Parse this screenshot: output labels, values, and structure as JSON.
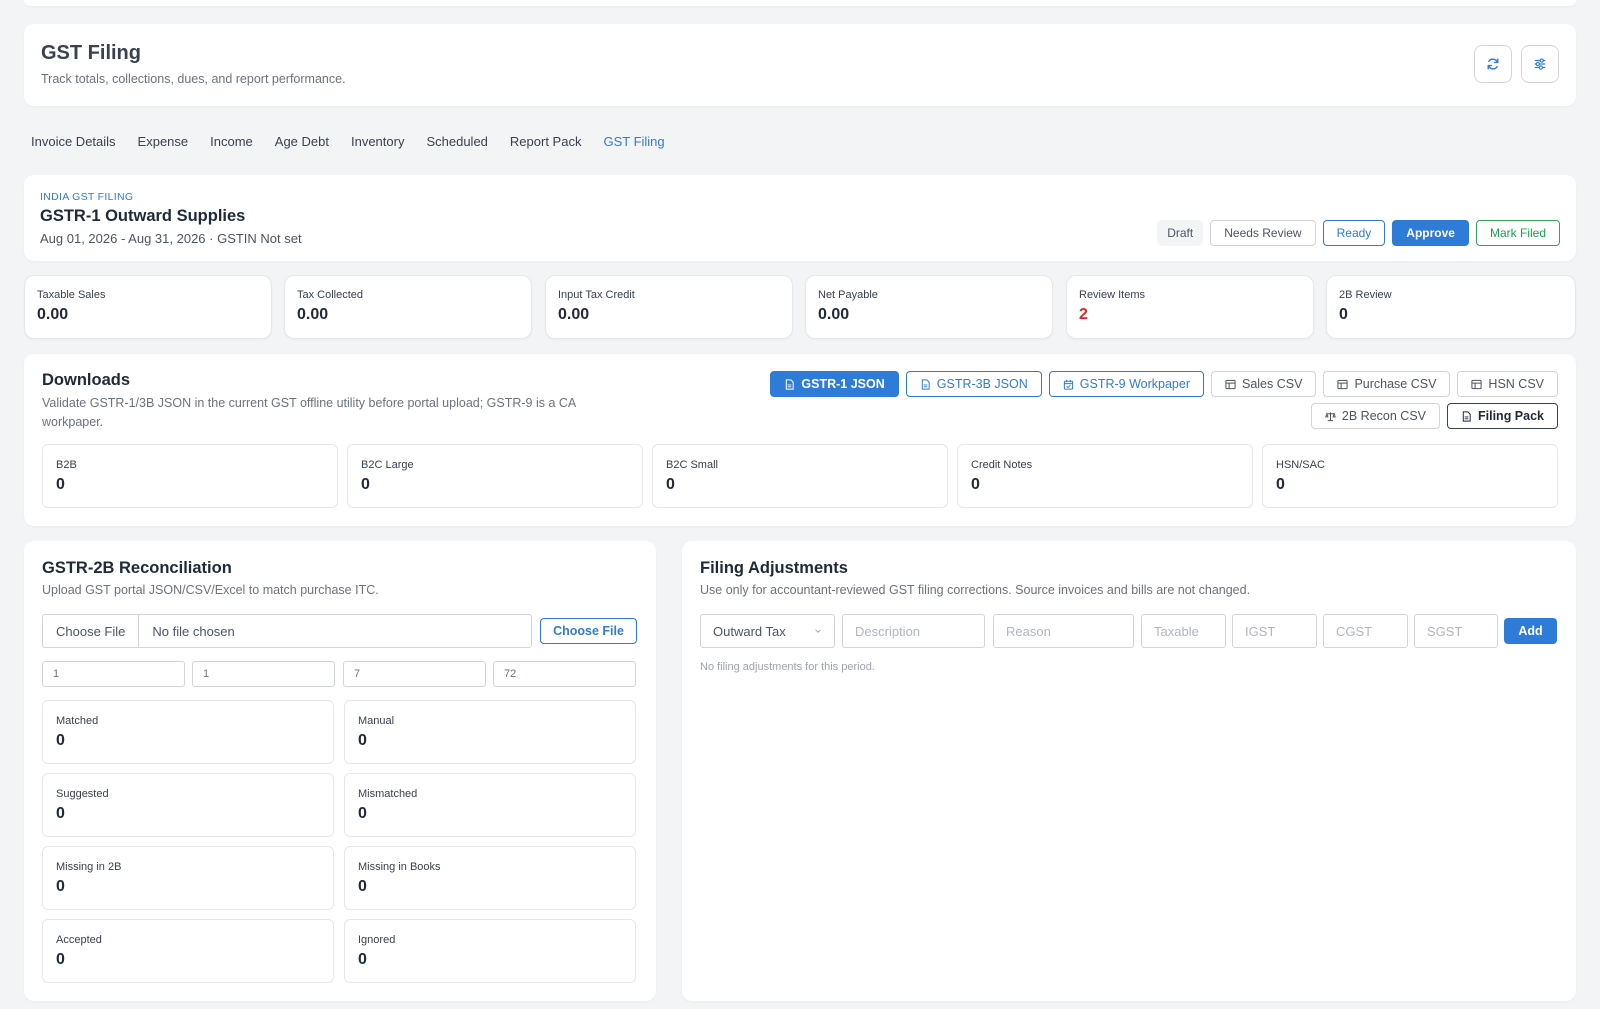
{
  "header": {
    "title": "GST Filing",
    "subtitle": "Track totals, collections, dues, and report performance."
  },
  "icons": {
    "refresh": "refresh-icon",
    "settings": "sliders-icon"
  },
  "tabs": [
    {
      "label": "Invoice Details"
    },
    {
      "label": "Expense"
    },
    {
      "label": "Income"
    },
    {
      "label": "Age Debt"
    },
    {
      "label": "Inventory"
    },
    {
      "label": "Scheduled"
    },
    {
      "label": "Report Pack"
    },
    {
      "label": "GST Filing",
      "active": true
    }
  ],
  "gstr1": {
    "eyebrow": "INDIA GST FILING",
    "title": "GSTR-1 Outward Supplies",
    "period": "Aug 01, 2026 - Aug 31, 2026 · GSTIN Not set",
    "status": {
      "draft": "Draft",
      "needs_review": "Needs Review",
      "ready": "Ready",
      "approve": "Approve",
      "mark_filed": "Mark Filed"
    }
  },
  "stats": [
    {
      "label": "Taxable Sales",
      "value": "0.00"
    },
    {
      "label": "Tax Collected",
      "value": "0.00"
    },
    {
      "label": "Input Tax Credit",
      "value": "0.00"
    },
    {
      "label": "Net Payable",
      "value": "0.00"
    },
    {
      "label": "Review Items",
      "value": "2"
    },
    {
      "label": "2B Review",
      "value": "0"
    }
  ],
  "downloads": {
    "title": "Downloads",
    "description": "Validate GSTR-1/3B JSON in the current GST offline utility before portal upload; GSTR-9 is a CA workpaper.",
    "buttons": {
      "gstr1_json": "GSTR-1 JSON",
      "gstr3b_json": "GSTR-3B JSON",
      "gstr9": "GSTR-9 Workpaper",
      "sales_csv": "Sales CSV",
      "purchase_csv": "Purchase CSV",
      "hsn_csv": "HSN CSV",
      "recon_csv": "2B Recon CSV",
      "filing_pack": "Filing Pack"
    },
    "summary": [
      {
        "label": "B2B",
        "value": "0"
      },
      {
        "label": "B2C Large",
        "value": "0"
      },
      {
        "label": "B2C Small",
        "value": "0"
      },
      {
        "label": "Credit Notes",
        "value": "0"
      },
      {
        "label": "HSN/SAC",
        "value": "0"
      }
    ]
  },
  "recon": {
    "title": "GSTR-2B Reconciliation",
    "description": "Upload GST portal JSON/CSV/Excel to match purchase ITC.",
    "file_button": "Choose File",
    "file_status": "No file chosen",
    "choose_label": "Choose File",
    "inputs": [
      "1",
      "1",
      "7",
      "72"
    ],
    "boxes": [
      {
        "label": "Matched",
        "value": "0"
      },
      {
        "label": "Manual",
        "value": "0"
      },
      {
        "label": "Suggested",
        "value": "0"
      },
      {
        "label": "Mismatched",
        "value": "0"
      },
      {
        "label": "Missing in 2B",
        "value": "0"
      },
      {
        "label": "Missing in Books",
        "value": "0"
      },
      {
        "label": "Accepted",
        "value": "0"
      },
      {
        "label": "Ignored",
        "value": "0"
      }
    ]
  },
  "adjustments": {
    "title": "Filing Adjustments",
    "description": "Use only for accountant-reviewed GST filing corrections. Source invoices and bills are not changed.",
    "type_selected": "Outward Tax",
    "placeholders": {
      "description": "Description",
      "reason": "Reason",
      "taxable": "Taxable",
      "igst": "IGST",
      "cgst": "CGST",
      "sgst": "SGST"
    },
    "add_label": "Add",
    "empty": "No filing adjustments for this period."
  },
  "colors": {
    "accent": "#2f7bd8",
    "success": "#16a34a",
    "danger": "#dc2626"
  }
}
